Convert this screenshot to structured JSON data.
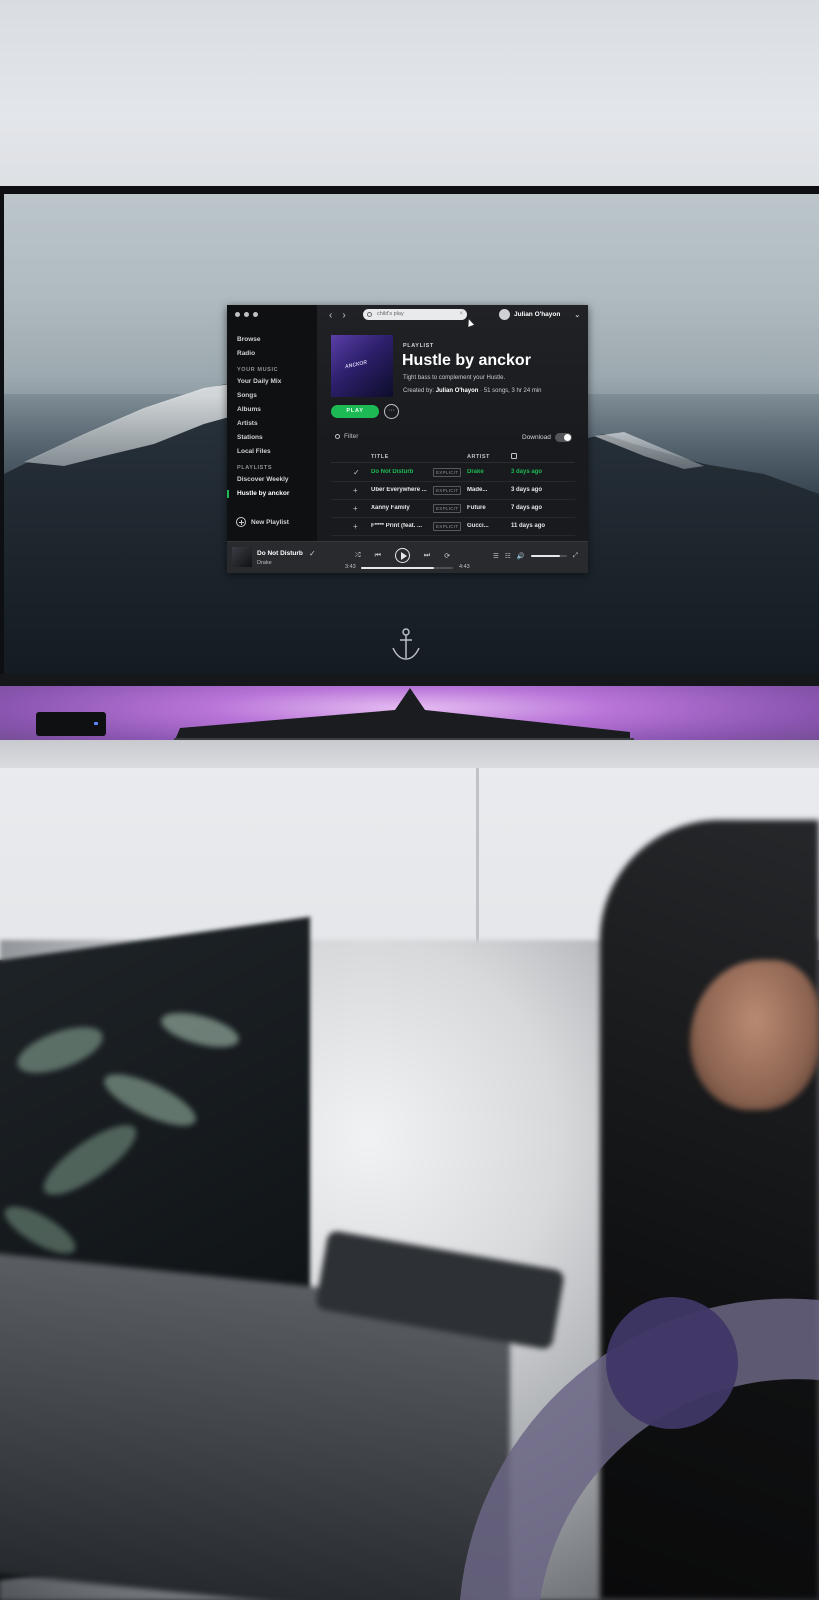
{
  "spotify": {
    "sidebar": {
      "items_top": [
        "Browse",
        "Radio"
      ],
      "your_music_heading": "YOUR MUSIC",
      "your_music": [
        "Your Daily Mix",
        "Songs",
        "Albums",
        "Artists",
        "Stations",
        "Local Files"
      ],
      "playlists_heading": "PLAYLISTS",
      "playlists": [
        "Discover Weekly",
        "Hustle by anckor"
      ],
      "new_playlist": "New Playlist"
    },
    "topbar": {
      "search_value": "child's play",
      "user_name": "Julian O'hayon"
    },
    "playlist": {
      "label": "PLAYLIST",
      "title": "Hustle by anckor",
      "description": "Tight bass to complement your Hustle.",
      "created_by_prefix": "Created by:",
      "created_by": "Julian O'hayon",
      "stats": "· 51 songs, 3 hr 24 min",
      "play_label": "PLAY",
      "more_label": "···",
      "filter_label": "Filter",
      "download_label": "Download"
    },
    "table": {
      "headers": {
        "title": "TITLE",
        "artist": "ARTIST"
      },
      "rows": [
        {
          "mark": "✓",
          "title": "Do Not Disturb",
          "explicit": "EXPLICIT",
          "artist": "Drake",
          "date": "3 days ago"
        },
        {
          "mark": "+",
          "title": "Uber Everywhere ...",
          "explicit": "EXPLICIT",
          "artist": "Made...",
          "date": "3 days ago"
        },
        {
          "mark": "+",
          "title": "Xanny Family",
          "explicit": "EXPLICIT",
          "artist": "Future",
          "date": "7 days ago"
        },
        {
          "mark": "+",
          "title": "F**** Print (feat. ...",
          "explicit": "EXPLICIT",
          "artist": "Gucci...",
          "date": "11 days ago"
        }
      ]
    },
    "now_playing": {
      "title": "Do Not Disturb",
      "artist": "Drake",
      "check": "✓",
      "time_current": "3:43",
      "time_total": "4:43",
      "progress": 0.79,
      "volume": 0.8
    },
    "colors": {
      "accent": "#1db954"
    }
  }
}
